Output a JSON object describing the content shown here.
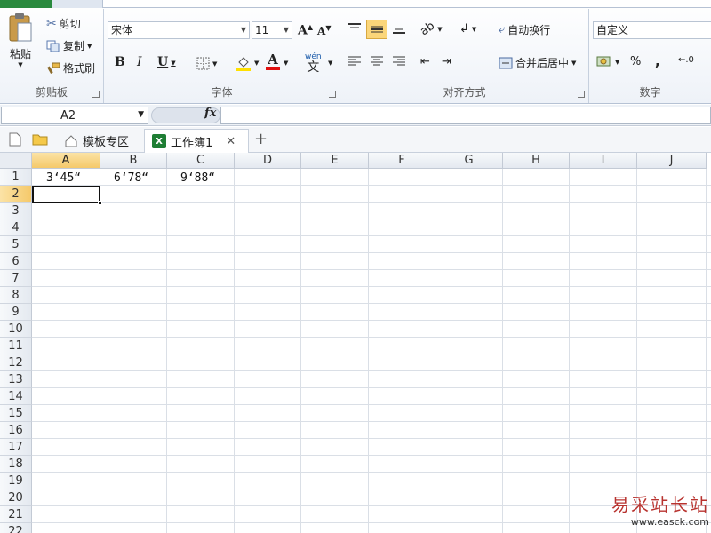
{
  "ribbon": {
    "clipboard": {
      "group_label": "剪贴板",
      "paste_label": "粘贴",
      "cut_label": "剪切",
      "copy_label": "复制",
      "format_painter_label": "格式刷"
    },
    "font": {
      "group_label": "字体",
      "font_name": "宋体",
      "font_size": "11",
      "bold": "B",
      "italic": "I",
      "underline": "U",
      "font_color_letter": "A",
      "wen_label": "wén"
    },
    "alignment": {
      "group_label": "对齐方式",
      "wrap_text_label": "自动换行",
      "merge_center_label": "合并后居中"
    },
    "number": {
      "group_label": "数字",
      "format_value": "自定义",
      "percent": "%",
      "comma": ","
    }
  },
  "formula_bar": {
    "name_box": "A2",
    "fx": "fx",
    "formula": ""
  },
  "doc_tabs": {
    "template_tab": "模板专区",
    "workbook_tab": "工作簿1",
    "xl_badge": "X",
    "add_label": "+",
    "close_label": "✕"
  },
  "grid": {
    "columns": [
      "A",
      "B",
      "C",
      "D",
      "E",
      "F",
      "G",
      "H",
      "I",
      "J"
    ],
    "rows": [
      "1",
      "2",
      "3",
      "4",
      "5",
      "6",
      "7",
      "8",
      "9",
      "10",
      "11",
      "12",
      "13",
      "14",
      "15",
      "16",
      "17",
      "18",
      "19",
      "20",
      "21",
      "22"
    ],
    "cells": {
      "A1": "3‘45“",
      "B1": "6‘78“",
      "C1": "9‘88“"
    },
    "selected_column": "A",
    "selected_row": "2"
  },
  "watermark": {
    "text": "易采站长站",
    "url": "www.easck.com"
  },
  "colors": {
    "file_tab": "#2a8a3e",
    "selection_header": "#f5c96a",
    "watermark": "#b8332f"
  }
}
